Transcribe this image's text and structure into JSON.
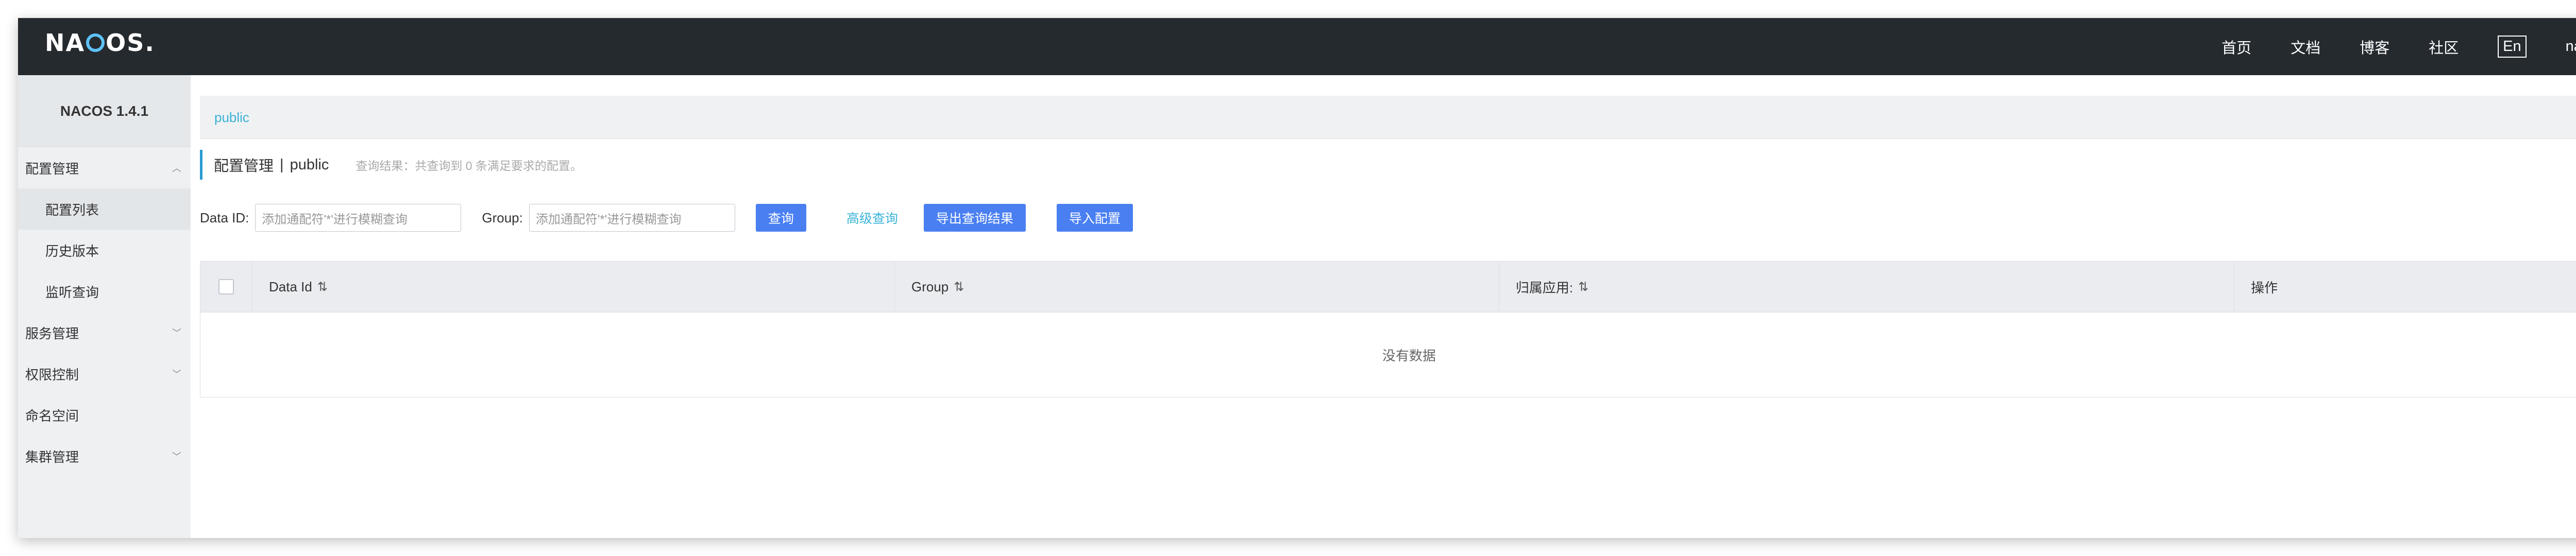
{
  "topbar": {
    "logo_left": "NA",
    "logo_right": "OS.",
    "nav": [
      "首页",
      "文档",
      "博客",
      "社区"
    ],
    "lang": "En",
    "user": "nacos"
  },
  "sidebar": {
    "version": "NACOS 1.4.1",
    "config_group": "配置管理",
    "config_items": [
      "配置列表",
      "历史版本",
      "监听查询"
    ],
    "service_group": "服务管理",
    "auth_group": "权限控制",
    "namespace": "命名空间",
    "cluster_group": "集群管理"
  },
  "namespace_bar": {
    "current": "public"
  },
  "title": {
    "main": "配置管理",
    "sep": "|",
    "ns": "public",
    "hint": "查询结果：共查询到 0 条满足要求的配置。"
  },
  "filters": {
    "dataid_label": "Data ID:",
    "dataid_placeholder": "添加通配符'*'进行模糊查询",
    "group_label": "Group:",
    "group_placeholder": "添加通配符'*'进行模糊查询",
    "query_btn": "查询",
    "advanced": "高级查询",
    "export_btn": "导出查询结果",
    "import_btn": "导入配置"
  },
  "table": {
    "headers": [
      "Data Id",
      "Group",
      "归属应用:",
      "操作"
    ],
    "empty": "没有数据"
  },
  "icons": {
    "sort": "sort-arrows-icon",
    "plus": "plus-icon",
    "chevron": "chevron-icon"
  },
  "colors": {
    "topbar": "#252a2f",
    "primary": "#4a7ff2",
    "link": "#3ab3d8",
    "sidebar": "#eef0f2"
  }
}
